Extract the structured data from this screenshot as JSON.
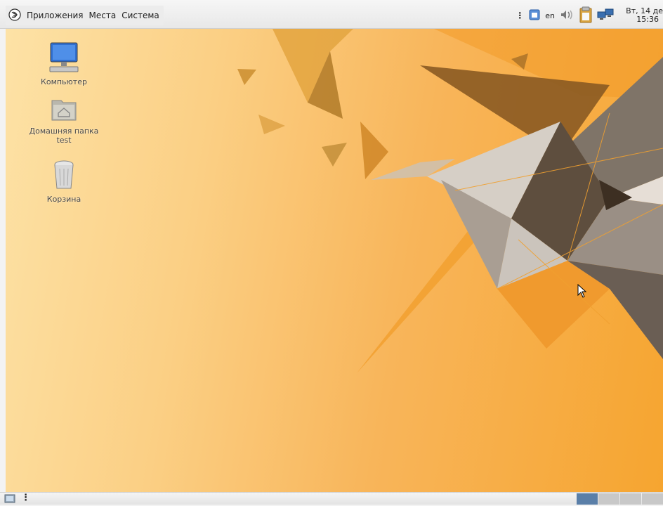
{
  "top_panel": {
    "menu": {
      "apps_icon": "mint-logo-icon",
      "applications": "Приложения",
      "places": "Места",
      "system": "Система"
    },
    "tray": {
      "keyboard_layout": "en",
      "clock_date": "Вт, 14 де",
      "clock_time": "15:36",
      "icons": [
        "clipboard-icon",
        "keyboard-icon",
        "volume-icon",
        "notes-icon",
        "network-icon"
      ]
    }
  },
  "desktop": {
    "icons": [
      {
        "label": "Компьютер",
        "icon": "computer-icon"
      },
      {
        "label": "Домашняя папка test",
        "icon": "home-folder-icon"
      },
      {
        "label": "Корзина",
        "icon": "trash-icon"
      }
    ]
  },
  "bottom_panel": {
    "show_desktop_icon": "show-desktop-icon",
    "workspaces": 4,
    "active_workspace": 1
  },
  "colors": {
    "wallpaper_light": "#fde2a6",
    "wallpaper_dark": "#f6a530",
    "workspace_active": "#5a7fa8"
  }
}
